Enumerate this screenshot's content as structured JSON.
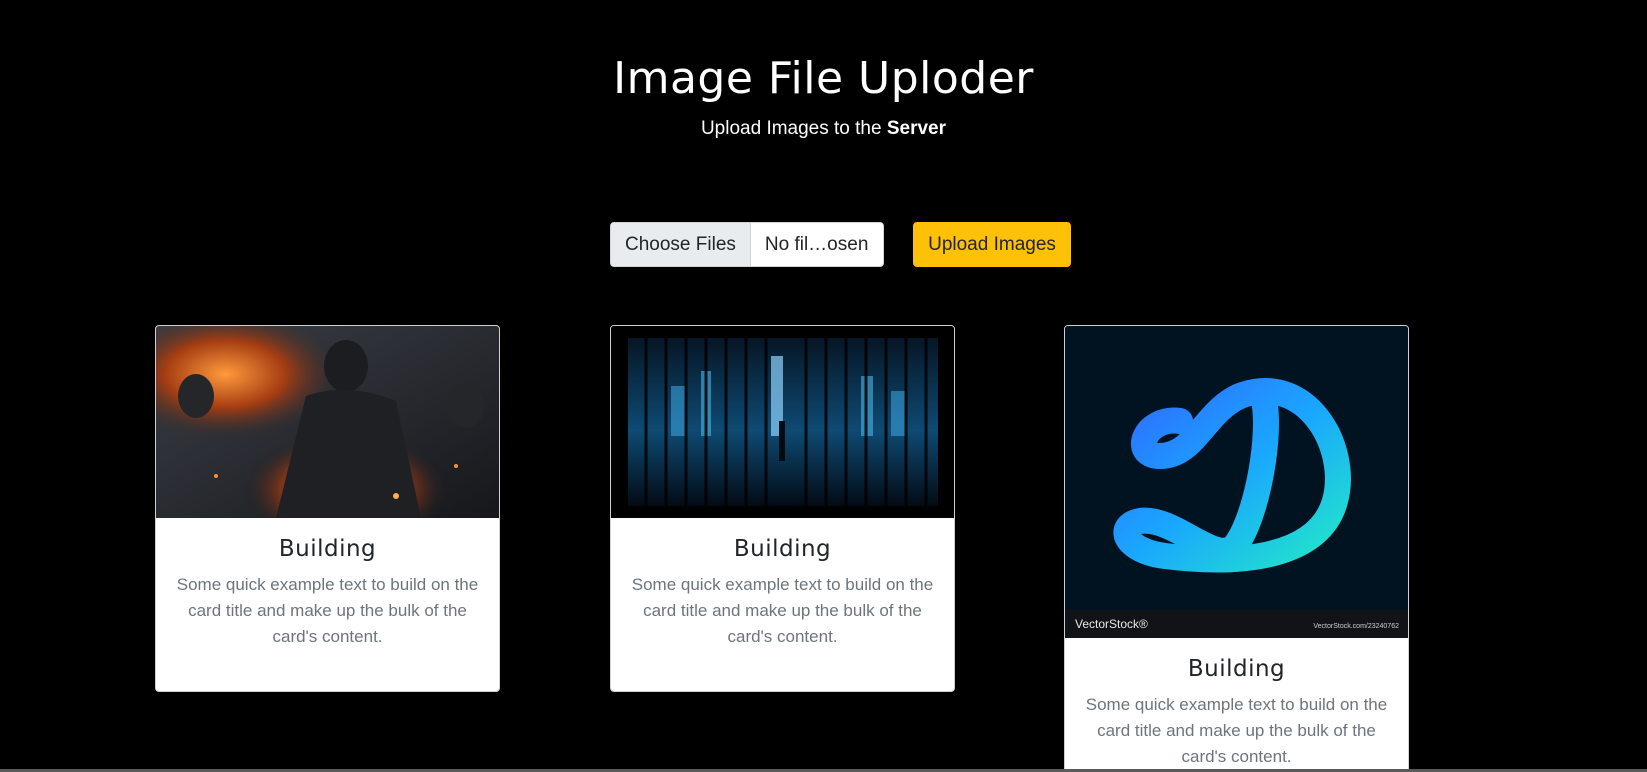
{
  "header": {
    "title": "Image File Uploder",
    "subtitle_prefix": "Upload Images to the",
    "subtitle_bold": "Server"
  },
  "upload": {
    "choose_label": "Choose Files",
    "file_status": "No fil…osen",
    "upload_label": "Upload Images",
    "accent_color": "#ffc107"
  },
  "cards": [
    {
      "image_icon": "soldier-fire-photo",
      "title": "Building",
      "text": "Some quick example text to build on the card title and make up the bulk of the card's content."
    },
    {
      "image_icon": "city-night-photo",
      "title": "Building",
      "text": "Some quick example text to build on the card title and make up the bulk of the card's content."
    },
    {
      "image_icon": "letter-d-logo",
      "image_caption_left": "VectorStock®",
      "image_caption_right": "VectorStock.com/23240762",
      "title": "Building",
      "text": "Some quick example text to build on the card title and make up the bulk of the card's content."
    }
  ]
}
